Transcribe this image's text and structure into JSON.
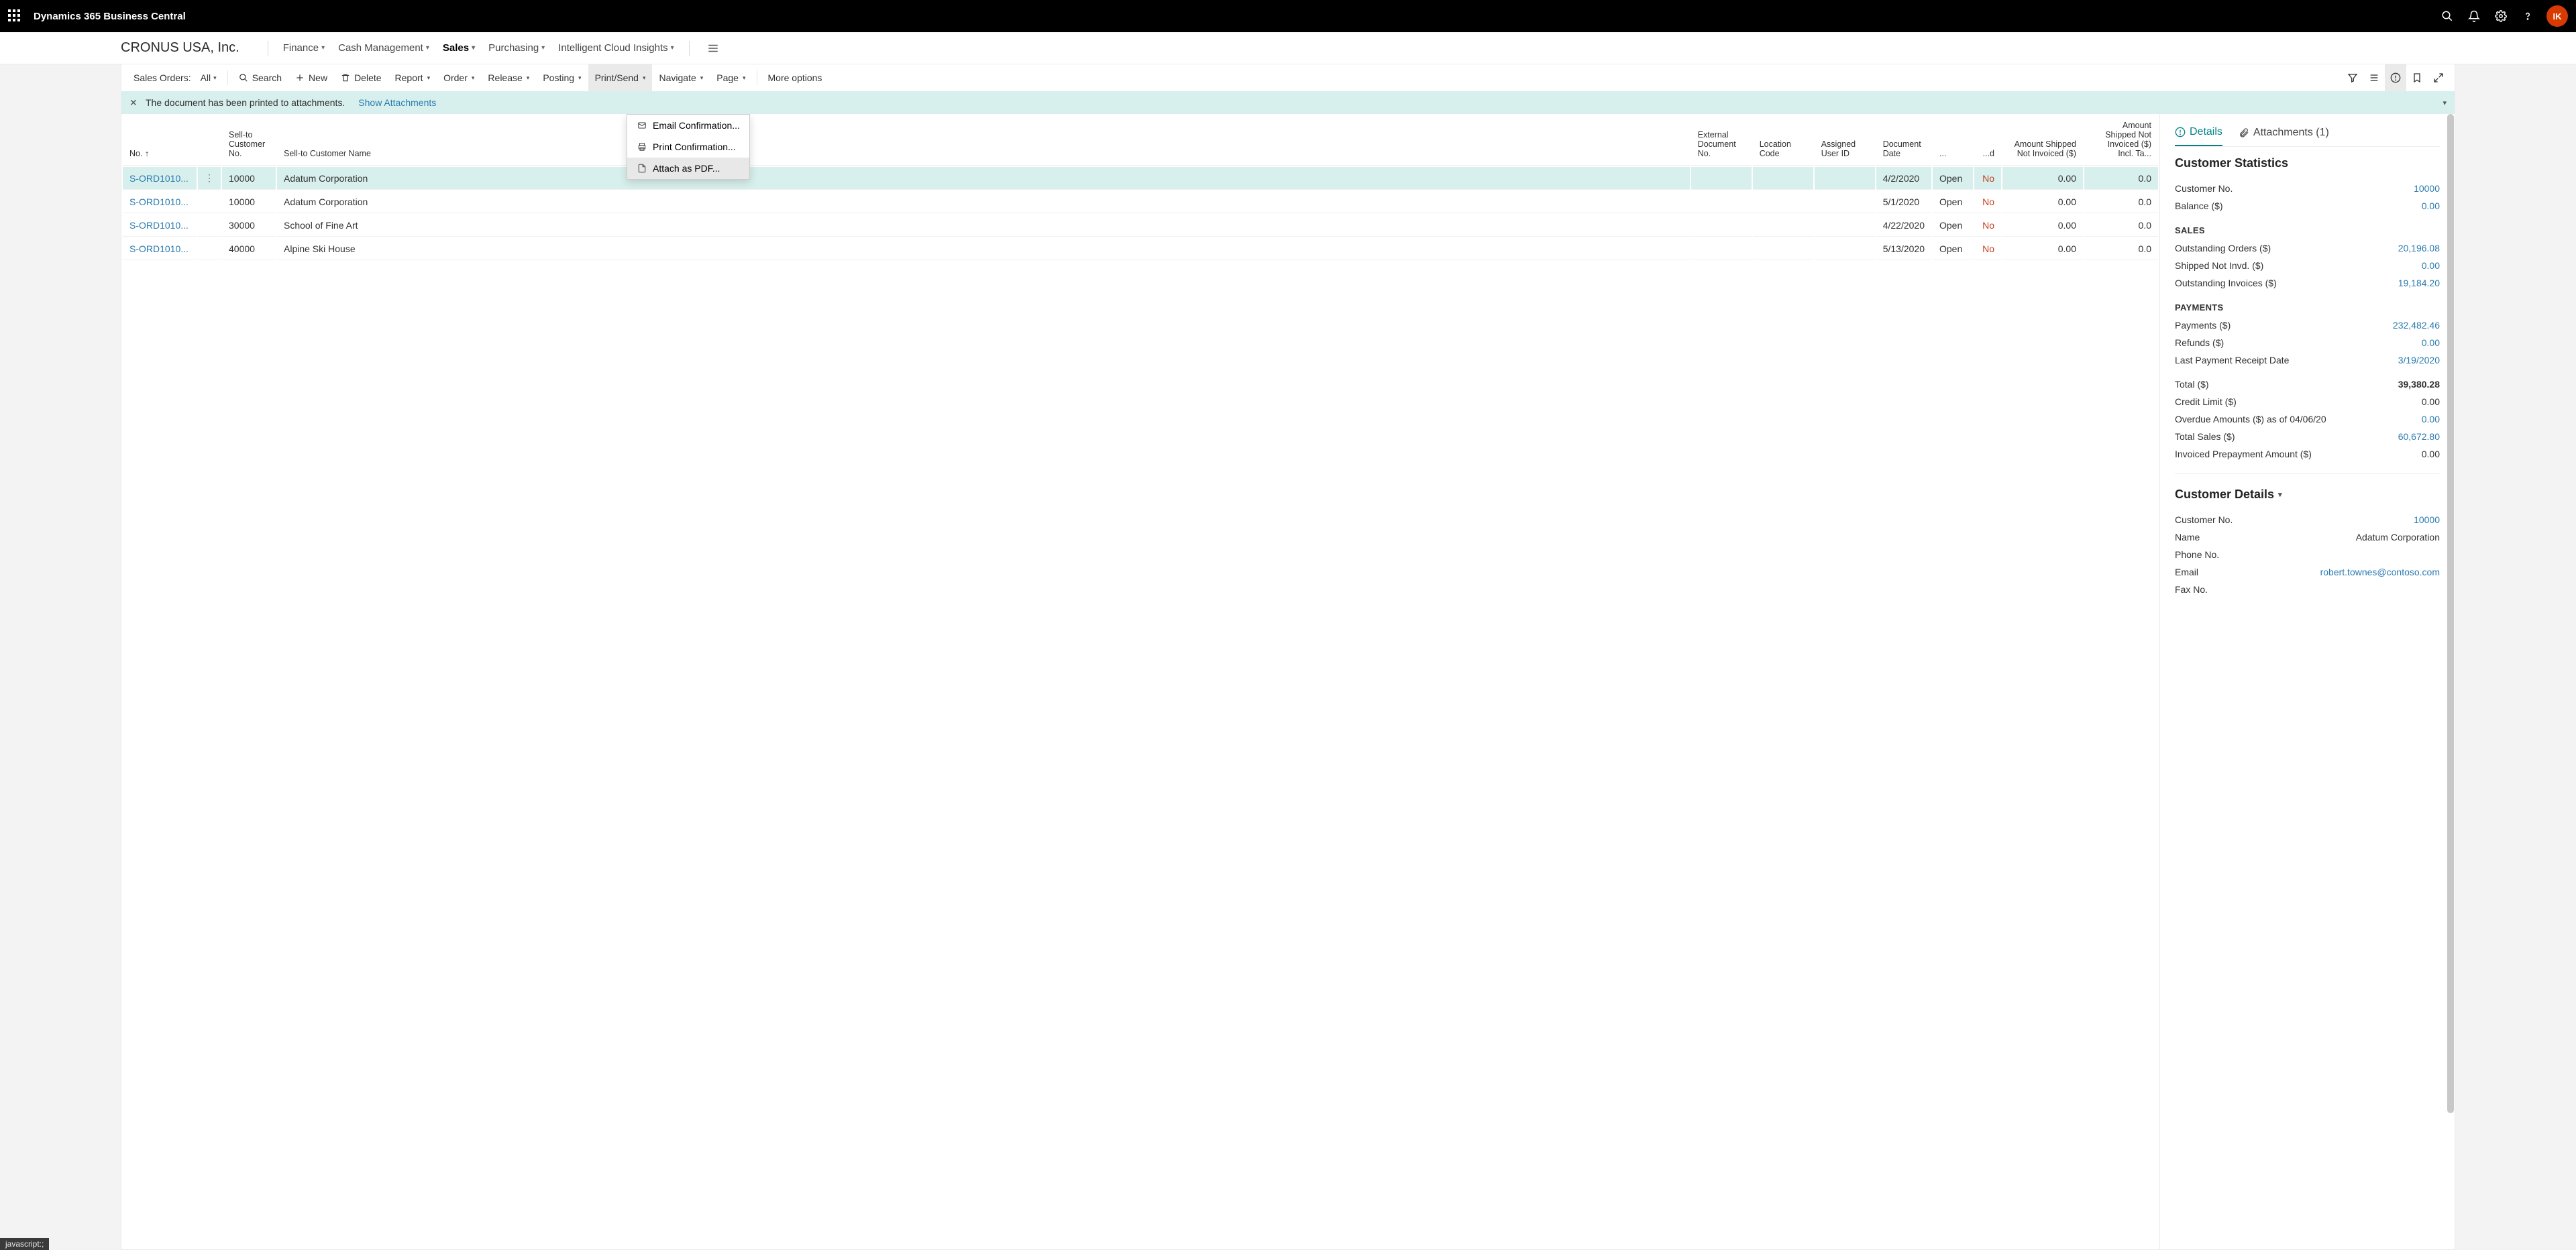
{
  "app": {
    "title": "Dynamics 365 Business Central",
    "avatar": "IK"
  },
  "company": "CRONUS USA, Inc.",
  "nav": {
    "finance": "Finance",
    "cash": "Cash Management",
    "sales": "Sales",
    "purchasing": "Purchasing",
    "cloud": "Intelligent Cloud Insights"
  },
  "actionbar": {
    "listlabel": "Sales Orders:",
    "filter": "All",
    "search": "Search",
    "new": "New",
    "delete": "Delete",
    "report": "Report",
    "order": "Order",
    "release": "Release",
    "posting": "Posting",
    "printsend": "Print/Send",
    "navigate": "Navigate",
    "page": "Page",
    "more": "More options"
  },
  "dropdown": {
    "email": "Email Confirmation...",
    "print": "Print Confirmation...",
    "attach": "Attach as PDF..."
  },
  "notif": {
    "msg": "The document has been printed to attachments.",
    "link": "Show Attachments"
  },
  "columns": {
    "no": "No. ↑",
    "sellno": "Sell-to Customer No.",
    "sellname": "Sell-to Customer Name",
    "extdoc": "External Document No.",
    "loc": "Location Code",
    "user": "Assigned User ID",
    "docdate": "Document Date",
    "status": "...",
    "completely": "...d",
    "amtshipped": "Amount Shipped Not Invoiced ($)",
    "amtshippedinc": "Amount Shipped Not Invoiced ($) Incl. Ta..."
  },
  "rows": [
    {
      "no": "S-ORD1010...",
      "custno": "10000",
      "custname": "Adatum Corporation",
      "date": "4/2/2020",
      "status": "Open",
      "comp": "No",
      "amt": "0.00",
      "amtinc": "0.0"
    },
    {
      "no": "S-ORD1010...",
      "custno": "10000",
      "custname": "Adatum Corporation",
      "date": "5/1/2020",
      "status": "Open",
      "comp": "No",
      "amt": "0.00",
      "amtinc": "0.0"
    },
    {
      "no": "S-ORD1010...",
      "custno": "30000",
      "custname": "School of Fine Art",
      "date": "4/22/2020",
      "status": "Open",
      "comp": "No",
      "amt": "0.00",
      "amtinc": "0.0"
    },
    {
      "no": "S-ORD1010...",
      "custno": "40000",
      "custname": "Alpine Ski House",
      "date": "5/13/2020",
      "status": "Open",
      "comp": "No",
      "amt": "0.00",
      "amtinc": "0.0"
    }
  ],
  "factbox": {
    "tab_details": "Details",
    "tab_attach": "Attachments (1)",
    "custstats": "Customer Statistics",
    "custno_k": "Customer No.",
    "custno_v": "10000",
    "balance_k": "Balance ($)",
    "balance_v": "0.00",
    "sales_h": "SALES",
    "outorders_k": "Outstanding Orders ($)",
    "outorders_v": "20,196.08",
    "shipni_k": "Shipped Not Invd. ($)",
    "shipni_v": "0.00",
    "outinv_k": "Outstanding Invoices ($)",
    "outinv_v": "19,184.20",
    "payments_h": "PAYMENTS",
    "payments_k": "Payments ($)",
    "payments_v": "232,482.46",
    "refunds_k": "Refunds ($)",
    "refunds_v": "0.00",
    "lastpay_k": "Last Payment Receipt Date",
    "lastpay_v": "3/19/2020",
    "total_k": "Total ($)",
    "total_v": "39,380.28",
    "credit_k": "Credit Limit ($)",
    "credit_v": "0.00",
    "overdue_k": "Overdue Amounts ($) as of 04/06/20",
    "overdue_v": "0.00",
    "totsales_k": "Total Sales ($)",
    "totsales_v": "60,672.80",
    "prepay_k": "Invoiced Prepayment Amount ($)",
    "prepay_v": "0.00",
    "custdet_h": "Customer Details",
    "cd_custno_k": "Customer No.",
    "cd_custno_v": "10000",
    "cd_name_k": "Name",
    "cd_name_v": "Adatum Corporation",
    "cd_phone_k": "Phone No.",
    "cd_email_k": "Email",
    "cd_email_v": "robert.townes@contoso.com",
    "cd_fax_k": "Fax No."
  },
  "status": "javascript:;"
}
